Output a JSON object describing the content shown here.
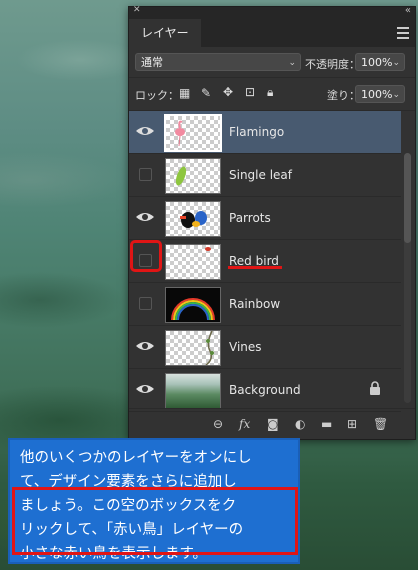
{
  "panel": {
    "tab": "レイヤー",
    "blend_mode": "通常",
    "opacity_label": "不透明度：",
    "opacity_value": "100%",
    "lock_label": "ロック：",
    "fill_label": "塗り：",
    "fill_value": "100%"
  },
  "layers": [
    {
      "name": "Flamingo",
      "visible": true,
      "selected": true
    },
    {
      "name": "Single leaf",
      "visible": false
    },
    {
      "name": "Parrots",
      "visible": true
    },
    {
      "name": "Red bird",
      "visible": false
    },
    {
      "name": "Rainbow",
      "visible": false
    },
    {
      "name": "Vines",
      "visible": true
    },
    {
      "name": "Background",
      "visible": true,
      "locked": true
    }
  ],
  "callout": {
    "line1": "他のいくつかのレイヤーをオンにし",
    "line2": "て、デザイン要素をさらに追加し",
    "line3": "ましょう。この空のボックスをク",
    "line4": "リックして、「赤い鳥」レイヤーの",
    "line5": "小さな赤い鳥を表示します。"
  },
  "colors": {
    "accent_red": "#e01515",
    "callout_blue": "#1e6fd1",
    "selection": "#485a70"
  }
}
